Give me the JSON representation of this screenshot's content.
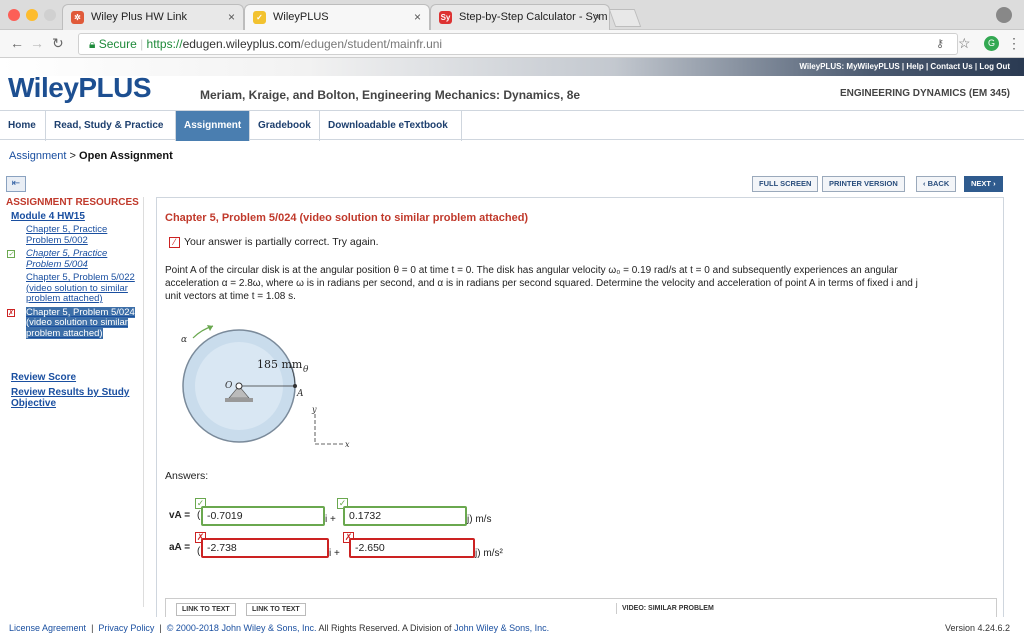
{
  "browser": {
    "tabs": [
      {
        "label": "Wiley Plus HW Link",
        "close": "×"
      },
      {
        "label": "WileyPLUS",
        "close": "×"
      },
      {
        "label": "Step-by-Step Calculator - Sym",
        "close": "×"
      }
    ],
    "secure_label": "Secure",
    "url_scheme": "https://",
    "url_host": "edugen.wileyplus.com",
    "url_path": "/edugen/student/mainfr.uni"
  },
  "header": {
    "toplinks": [
      "WileyPLUS:",
      "MyWileyPLUS",
      "Help",
      "Contact Us",
      "Log Out"
    ],
    "logo": "WileyPLUS",
    "book_title": "Meriam, Kraige, and Bolton, Engineering Mechanics: Dynamics, 8e",
    "course": "ENGINEERING DYNAMICS (EM 345)"
  },
  "nav": {
    "tabs": [
      "Home",
      "Read, Study & Practice",
      "Assignment",
      "Gradebook",
      "Downloadable eTextbook"
    ]
  },
  "breadcrumb": {
    "link": "Assignment",
    "sep": ">",
    "current": "Open Assignment"
  },
  "toolbar": {
    "full_screen": "FULL SCREEN",
    "printer": "PRINTER VERSION",
    "back": "‹ BACK",
    "next": "NEXT ›"
  },
  "sidebar": {
    "title": "ASSIGNMENT RESOURCES",
    "module": "Module 4 HW15",
    "items": [
      {
        "label": "Chapter 5, Practice Problem 5/002",
        "mark": ""
      },
      {
        "label": "Chapter 5, Practice Problem 5/004",
        "mark": "✓"
      },
      {
        "label": "Chapter 5, Problem 5/022 (video solution to similar problem attached)",
        "mark": ""
      },
      {
        "label": "Chapter 5, Problem 5/024 (video solution to similar problem attached)",
        "mark": "✗"
      }
    ],
    "review_score": "Review Score",
    "review_results": "Review Results by Study Objective"
  },
  "problem": {
    "title": "Chapter 5, Problem 5/024 (video solution to similar problem attached)",
    "status": "Your answer is partially correct.  Try again.",
    "text1": "Point A of the circular disk is at the angular position θ = 0 at time t = 0. The disk has angular velocity ω₀ = 0.19 rad/s at t = 0 and subsequently experiences an angular",
    "text2": "acceleration α = 2.8ω, where ω is in radians per second, and α is in radians per second squared. Determine the velocity and acceleration of point A in terms of fixed i and j",
    "text3": "unit vectors at time t = 1.08 s.",
    "figure": {
      "radius_label": "185 mm",
      "alpha": "α",
      "theta": "θ",
      "point": "A",
      "origin": "O",
      "y": "y",
      "x": "x"
    },
    "answers_label": "Answers:",
    "va_label": "vA =",
    "va_i": "-0.7019",
    "va_j": "0.1732",
    "va_unit": "j) m/s",
    "aa_label": "aA =",
    "aa_i": "-2.738",
    "aa_j": "-2.650",
    "aa_unit": "j) m/s²",
    "i_plus": "i +",
    "paren": "(",
    "links": [
      "LINK TO TEXT",
      "LINK TO TEXT",
      "VIDEO: SIMILAR PROBLEM"
    ]
  },
  "footer": {
    "license": "License Agreement",
    "privacy": "Privacy Policy",
    "copyright": "© 2000-2018 John Wiley & Sons, Inc.",
    "rights": "All Rights Reserved. A Division of",
    "company": "John Wiley & Sons, Inc.",
    "version": "Version 4.24.6.2"
  },
  "colors": {
    "accent": "#1d4f91",
    "error": "#cc2222",
    "correct": "#6aa84f",
    "selected_tab": "#4a7eb0"
  }
}
